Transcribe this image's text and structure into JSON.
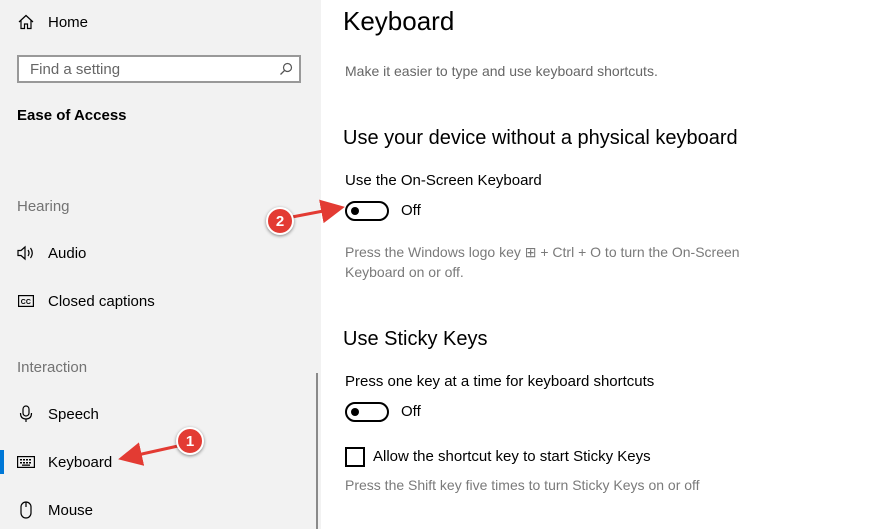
{
  "sidebar": {
    "home_label": "Home",
    "search_placeholder": "Find a setting",
    "section": "Ease of Access",
    "groups": {
      "hearing": "Hearing",
      "interaction": "Interaction"
    },
    "items": [
      {
        "label": "Audio",
        "icon": "speaker-icon"
      },
      {
        "label": "Closed captions",
        "icon": "cc-icon"
      },
      {
        "label": "Speech",
        "icon": "microphone-icon"
      },
      {
        "label": "Keyboard",
        "icon": "keyboard-icon",
        "selected": true
      },
      {
        "label": "Mouse",
        "icon": "mouse-icon"
      }
    ]
  },
  "main": {
    "title": "Keyboard",
    "subtitle": "Make it easier to type and use keyboard shortcuts.",
    "onscreen": {
      "heading": "Use your device without a physical keyboard",
      "toggle_label": "Use the On-Screen Keyboard",
      "toggle_state": "Off",
      "desc_line1": "Press the Windows logo key ⊞ + Ctrl + O to turn the On-Screen",
      "desc_line2": "Keyboard on or off."
    },
    "sticky": {
      "heading": "Use Sticky Keys",
      "toggle_label": "Press one key at a time for keyboard shortcuts",
      "toggle_state": "Off",
      "checkbox_label": "Allow the shortcut key to start Sticky Keys",
      "checkbox_checked": false,
      "desc": "Press the Shift key five times to turn Sticky Keys on or off"
    }
  },
  "annotations": [
    {
      "number": "1"
    },
    {
      "number": "2"
    }
  ],
  "colors": {
    "accent": "#0078d7",
    "annotation": "#e33b33",
    "sidebar_bg": "#f2f2f2"
  }
}
